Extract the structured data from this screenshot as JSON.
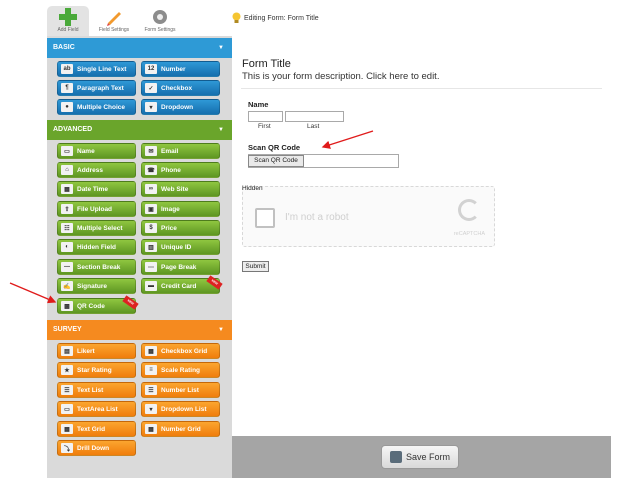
{
  "tabs": [
    {
      "label": "Add Field",
      "icon": "plus-icon"
    },
    {
      "label": "Field Settings",
      "icon": "pencil-icon"
    },
    {
      "label": "Form Settings",
      "icon": "gear-icon"
    }
  ],
  "editing_label": "Editing Form: Form Title",
  "sections": {
    "basic": {
      "title": "BASIC",
      "color": "#2e9ad6"
    },
    "advanced": {
      "title": "ADVANCED",
      "color": "#6aa52b"
    },
    "survey": {
      "title": "SURVEY",
      "color": "#f58a1f"
    }
  },
  "basic_fields": [
    {
      "label": "Single Line Text",
      "icon": "abc-icon"
    },
    {
      "label": "Number",
      "icon": "number-icon"
    },
    {
      "label": "Paragraph Text",
      "icon": "paragraph-icon"
    },
    {
      "label": "Checkbox",
      "icon": "checkbox-icon"
    },
    {
      "label": "Multiple Choice",
      "icon": "radio-icon"
    },
    {
      "label": "Dropdown",
      "icon": "dropdown-icon"
    }
  ],
  "advanced_fields": [
    {
      "label": "Name",
      "icon": "id-card-icon"
    },
    {
      "label": "Email",
      "icon": "envelope-icon"
    },
    {
      "label": "Address",
      "icon": "house-icon"
    },
    {
      "label": "Phone",
      "icon": "phone-icon"
    },
    {
      "label": "Date Time",
      "icon": "calendar-icon"
    },
    {
      "label": "Web Site",
      "icon": "link-icon"
    },
    {
      "label": "File Upload",
      "icon": "upload-icon"
    },
    {
      "label": "Image",
      "icon": "image-icon"
    },
    {
      "label": "Multiple Select",
      "icon": "multi-select-icon"
    },
    {
      "label": "Price",
      "icon": "dollar-icon"
    },
    {
      "label": "Hidden Field",
      "icon": "mask-icon"
    },
    {
      "label": "Unique ID",
      "icon": "barcode-icon"
    },
    {
      "label": "Section Break",
      "icon": "section-break-icon"
    },
    {
      "label": "Page Break",
      "icon": "page-break-icon"
    },
    {
      "label": "Signature",
      "icon": "signature-icon"
    },
    {
      "label": "Credit Card",
      "icon": "credit-card-icon"
    },
    {
      "label": "QR Code",
      "icon": "qr-code-icon"
    }
  ],
  "survey_fields": [
    {
      "label": "Likert",
      "icon": "likert-icon"
    },
    {
      "label": "Checkbox Grid",
      "icon": "checkbox-grid-icon"
    },
    {
      "label": "Star Rating",
      "icon": "star-icon"
    },
    {
      "label": "Scale Rating",
      "icon": "scale-icon"
    },
    {
      "label": "Text List",
      "icon": "text-list-icon"
    },
    {
      "label": "Number List",
      "icon": "number-list-icon"
    },
    {
      "label": "TextArea List",
      "icon": "textarea-list-icon"
    },
    {
      "label": "Dropdown List",
      "icon": "dropdown-list-icon"
    },
    {
      "label": "Text Grid",
      "icon": "text-grid-icon"
    },
    {
      "label": "Number Grid",
      "icon": "number-grid-icon"
    },
    {
      "label": "Drill Down",
      "icon": "drill-down-icon"
    }
  ],
  "form": {
    "title": "Form Title",
    "description": "This is your form description. Click here to edit.",
    "name_label": "Name",
    "first_label": "First",
    "last_label": "Last",
    "qr_label": "Scan QR Code",
    "qr_button": "Scan QR Code",
    "hidden_label": "Hidden",
    "captcha_text": "I'm not a robot",
    "captcha_brand": "reCAPTCHA",
    "submit_label": "Submit"
  },
  "save_button": "Save Form",
  "badges": {
    "pro": "NEW"
  }
}
